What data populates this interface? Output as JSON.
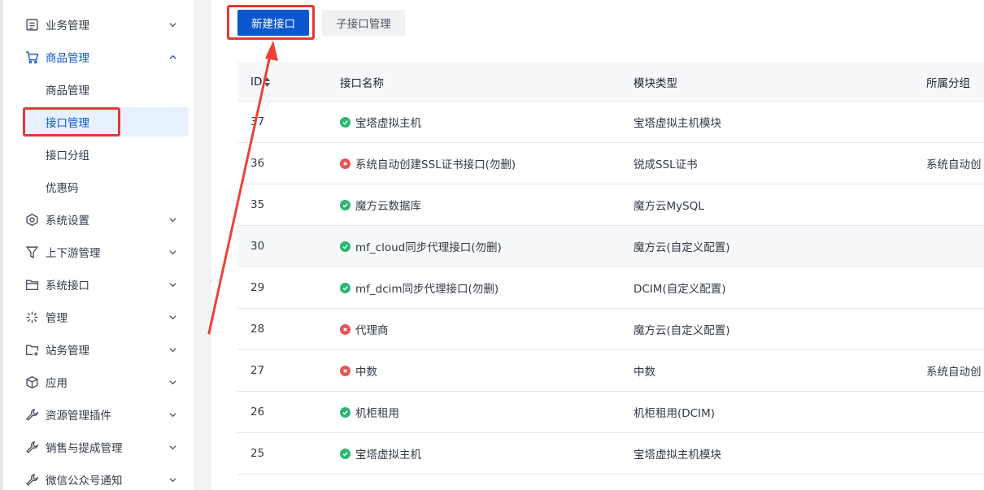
{
  "sidebar": {
    "items": [
      {
        "label": "业务管理",
        "icon": "list-icon"
      },
      {
        "label": "商品管理",
        "icon": "cart-icon",
        "open": true
      },
      {
        "label": "系统设置",
        "icon": "settings-icon"
      },
      {
        "label": "上下游管理",
        "icon": "filter-icon"
      },
      {
        "label": "系统接口",
        "icon": "folder-icon"
      },
      {
        "label": "管理",
        "icon": "spark-icon"
      },
      {
        "label": "站务管理",
        "icon": "folder-plus-icon"
      },
      {
        "label": "应用",
        "icon": "cube-icon"
      },
      {
        "label": "资源管理插件",
        "icon": "wrench-icon"
      },
      {
        "label": "销售与提成管理",
        "icon": "wrench-icon"
      },
      {
        "label": "微信公众号通知",
        "icon": "wrench-icon"
      }
    ],
    "sub_items": [
      {
        "label": "商品管理"
      },
      {
        "label": "接口管理",
        "active": true
      },
      {
        "label": "接口分组"
      },
      {
        "label": "优惠码"
      }
    ]
  },
  "toolbar": {
    "new_label": "新建接口",
    "sub_label": "子接口管理"
  },
  "table": {
    "headers": {
      "id": "ID",
      "name": "接口名称",
      "module": "模块类型",
      "group": "所属分组"
    },
    "rows": [
      {
        "id": "37",
        "status": "ok",
        "name": "宝塔虚拟主机",
        "module": "宝塔虚拟主机模块",
        "group": ""
      },
      {
        "id": "36",
        "status": "err",
        "name": "系统自动创建SSL证书接口(勿删)",
        "module": "锐成SSL证书",
        "group": "系统自动创"
      },
      {
        "id": "35",
        "status": "ok",
        "name": "魔方云数据库",
        "module": "魔方云MySQL",
        "group": ""
      },
      {
        "id": "30",
        "status": "ok",
        "name": "mf_cloud同步代理接口(勿删)",
        "module": "魔方云(自定义配置)",
        "group": ""
      },
      {
        "id": "29",
        "status": "ok",
        "name": "mf_dcim同步代理接口(勿删)",
        "module": "DCIM(自定义配置)",
        "group": ""
      },
      {
        "id": "28",
        "status": "err",
        "name": "代理商",
        "module": "魔方云(自定义配置)",
        "group": ""
      },
      {
        "id": "27",
        "status": "err",
        "name": "中数",
        "module": "中数",
        "group": "系统自动创"
      },
      {
        "id": "26",
        "status": "ok",
        "name": "机柜租用",
        "module": "机柜租用(DCIM)",
        "group": ""
      },
      {
        "id": "25",
        "status": "ok",
        "name": "宝塔虚拟主机",
        "module": "宝塔虚拟主机模块",
        "group": ""
      }
    ]
  },
  "colors": {
    "primary": "#0b57d0",
    "annotation_red": "#e53935",
    "ok": "#2bb673",
    "err": "#e55454"
  }
}
